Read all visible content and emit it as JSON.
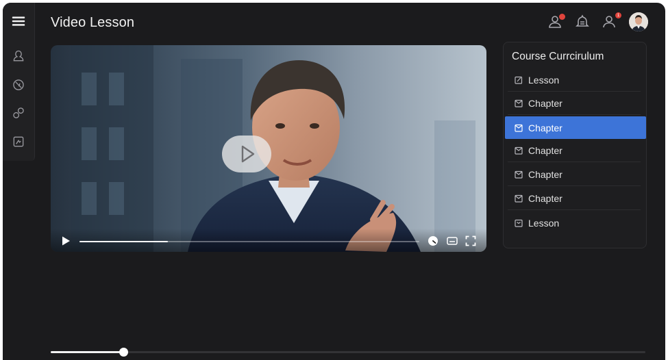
{
  "header": {
    "title": "Video Lesson",
    "notification_badge": "",
    "profile_badge": "1"
  },
  "sidebar": {
    "items": [
      {
        "icon": "menu-icon"
      },
      {
        "icon": "user-icon"
      },
      {
        "icon": "compass-icon"
      },
      {
        "icon": "link-icon"
      },
      {
        "icon": "image-icon"
      }
    ]
  },
  "video": {
    "progress": 0.26
  },
  "curriculum": {
    "title": "Course Currcirulum",
    "items": [
      {
        "label": "Lesson",
        "icon": "edit-icon"
      },
      {
        "label": "Chapter",
        "icon": "chapter-icon"
      },
      {
        "label": "Chapter",
        "icon": "chapter-icon",
        "active": true
      },
      {
        "label": "Chapter",
        "icon": "chapter-icon"
      },
      {
        "label": "Chapter",
        "icon": "chapter-icon"
      },
      {
        "label": "Chapter",
        "icon": "chapter-icon"
      },
      {
        "label": "Lesson",
        "icon": "lesson-icon"
      }
    ]
  },
  "timeline": {
    "progress": 0.122
  },
  "colors": {
    "background": "#1b1b1d",
    "accent": "#3d74d8",
    "badge": "#e0443c"
  }
}
